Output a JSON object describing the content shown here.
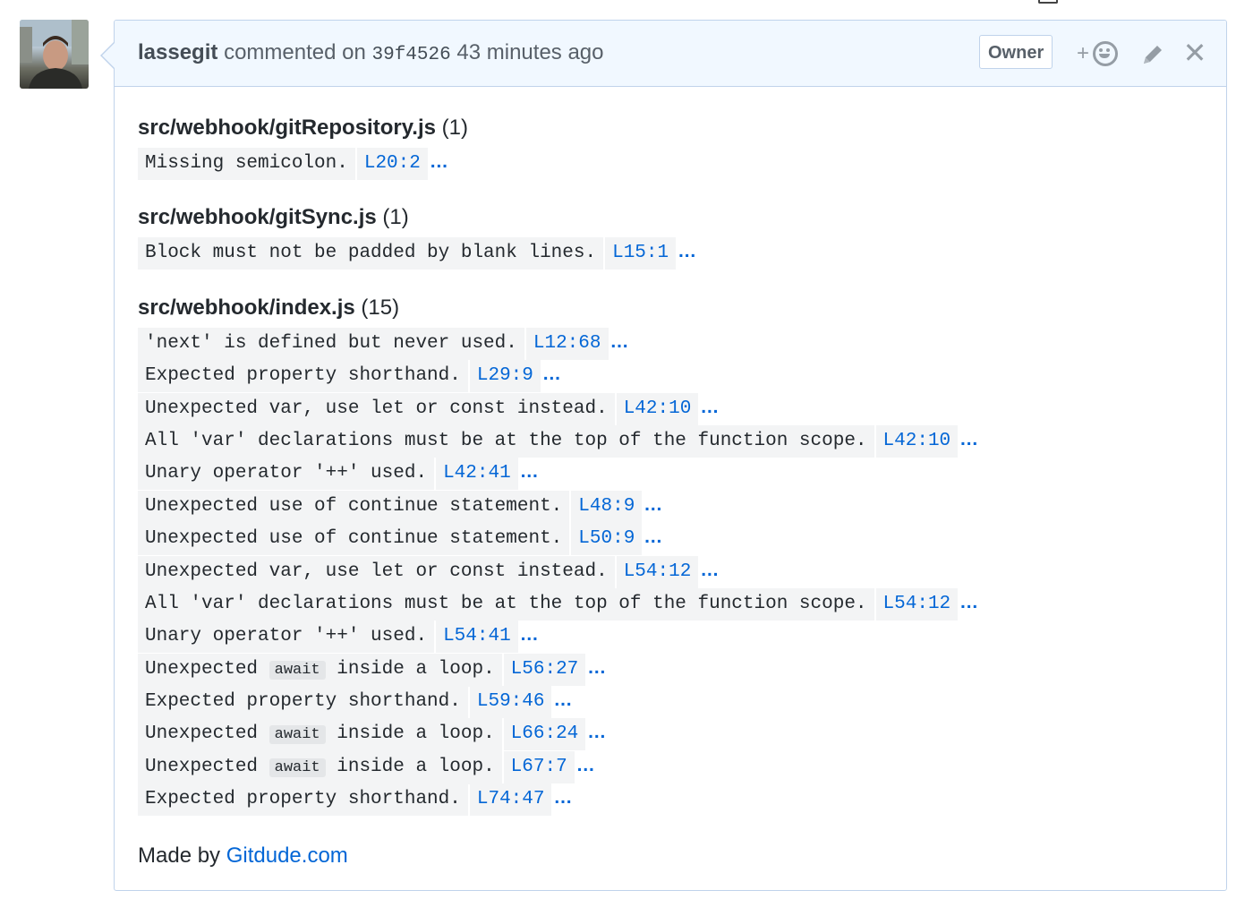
{
  "comment": {
    "author": "lassegit",
    "action": "commented on",
    "commit_sha": "39f4526",
    "time_ago": "43 minutes ago",
    "role_badge": "Owner",
    "reaction_plus": "+",
    "close_glyph": "✕"
  },
  "icons": {
    "avatar": "avatar",
    "reaction": "smiley-icon",
    "edit": "pencil-icon",
    "close": "close-icon"
  },
  "files": [
    {
      "path": "src/webhook/gitRepository.js",
      "count": "(1)",
      "issues": [
        {
          "parts": [
            {
              "t": "Missing semicolon."
            }
          ],
          "loc": "L20:2"
        }
      ]
    },
    {
      "path": "src/webhook/gitSync.js",
      "count": "(1)",
      "issues": [
        {
          "parts": [
            {
              "t": "Block must not be padded by blank lines."
            }
          ],
          "loc": "L15:1"
        }
      ]
    },
    {
      "path": "src/webhook/index.js",
      "count": "(15)",
      "issues": [
        {
          "parts": [
            {
              "t": "'next' is defined but never used."
            }
          ],
          "loc": "L12:68"
        },
        {
          "parts": [
            {
              "t": "Expected property shorthand."
            }
          ],
          "loc": "L29:9"
        },
        {
          "parts": [
            {
              "t": "Unexpected var, use let or const instead."
            }
          ],
          "loc": "L42:10"
        },
        {
          "parts": [
            {
              "t": "All 'var' declarations must be at the top of the function scope."
            }
          ],
          "loc": "L42:10"
        },
        {
          "parts": [
            {
              "t": "Unary operator '++' used."
            }
          ],
          "loc": "L42:41"
        },
        {
          "parts": [
            {
              "t": "Unexpected use of continue statement."
            }
          ],
          "loc": "L48:9"
        },
        {
          "parts": [
            {
              "t": "Unexpected use of continue statement."
            }
          ],
          "loc": "L50:9"
        },
        {
          "parts": [
            {
              "t": "Unexpected var, use let or const instead."
            }
          ],
          "loc": "L54:12"
        },
        {
          "parts": [
            {
              "t": "All 'var' declarations must be at the top of the function scope."
            }
          ],
          "loc": "L54:12"
        },
        {
          "parts": [
            {
              "t": "Unary operator '++' used."
            }
          ],
          "loc": "L54:41"
        },
        {
          "parts": [
            {
              "t": "Unexpected "
            },
            {
              "c": "await"
            },
            {
              "t": " inside a loop."
            }
          ],
          "loc": "L56:27"
        },
        {
          "parts": [
            {
              "t": "Expected property shorthand."
            }
          ],
          "loc": "L59:46"
        },
        {
          "parts": [
            {
              "t": "Unexpected "
            },
            {
              "c": "await"
            },
            {
              "t": " inside a loop."
            }
          ],
          "loc": "L66:24"
        },
        {
          "parts": [
            {
              "t": "Unexpected "
            },
            {
              "c": "await"
            },
            {
              "t": " inside a loop."
            }
          ],
          "loc": "L67:7"
        },
        {
          "parts": [
            {
              "t": "Expected property shorthand."
            }
          ],
          "loc": "L74:47"
        }
      ]
    }
  ],
  "ellipsis": "…",
  "footer": {
    "prefix": "Made by",
    "link_text": "Gitdude.com"
  },
  "colors": {
    "header_bg": "#f1f8ff",
    "border": "#c0d3eb",
    "link": "#0366d6",
    "code_bg": "#f3f4f5"
  }
}
